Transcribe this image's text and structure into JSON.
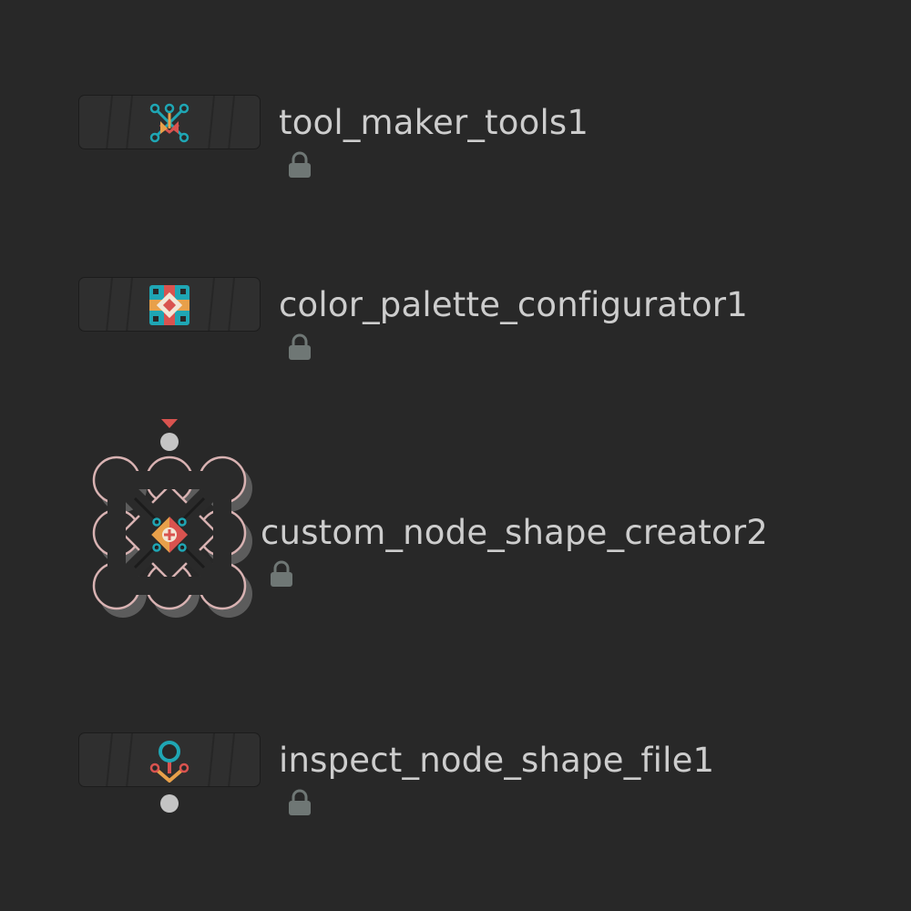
{
  "network": {
    "background": "#282828",
    "nodes": [
      {
        "name": "tool_maker_tools1",
        "icon": "tool-maker-icon",
        "locked": true
      },
      {
        "name": "color_palette_configurator1",
        "icon": "color-palette-icon",
        "locked": true
      },
      {
        "name": "custom_node_shape_creator2",
        "icon": "node-shape-creator-icon",
        "shape": "custom-cog",
        "locked": true,
        "display_flag_color": "#d9534f"
      },
      {
        "name": "inspect_node_shape_file1",
        "icon": "inspect-shape-icon",
        "locked": true
      }
    ],
    "colors": {
      "teal": "#1fa6b4",
      "orange": "#e8a04a",
      "red": "#d9534f",
      "label": "#cdcdcd",
      "lock": "#6f7775",
      "connector": "#c4c4c4"
    }
  }
}
